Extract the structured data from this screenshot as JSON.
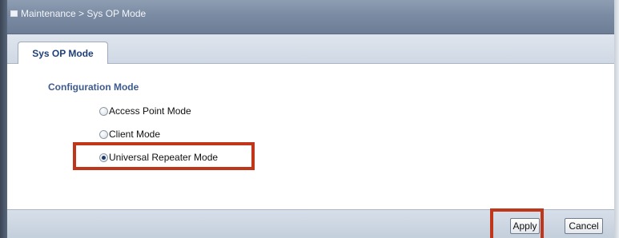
{
  "header": {
    "breadcrumb": "Maintenance > Sys OP Mode",
    "icon": "window-icon"
  },
  "tabs": [
    {
      "label": "Sys OP Mode",
      "active": true
    }
  ],
  "section": {
    "title": "Configuration Mode"
  },
  "options": [
    {
      "label": "Access Point Mode",
      "selected": false
    },
    {
      "label": "Client Mode",
      "selected": false
    },
    {
      "label": "Universal Repeater Mode",
      "selected": true
    }
  ],
  "footer": {
    "apply_label": "Apply",
    "cancel_label": "Cancel"
  },
  "colors": {
    "highlight": "#c0361a",
    "title_bar": "#7b8ba3",
    "section_title": "#3d5b8e",
    "tab_label": "#1f3f7a"
  }
}
